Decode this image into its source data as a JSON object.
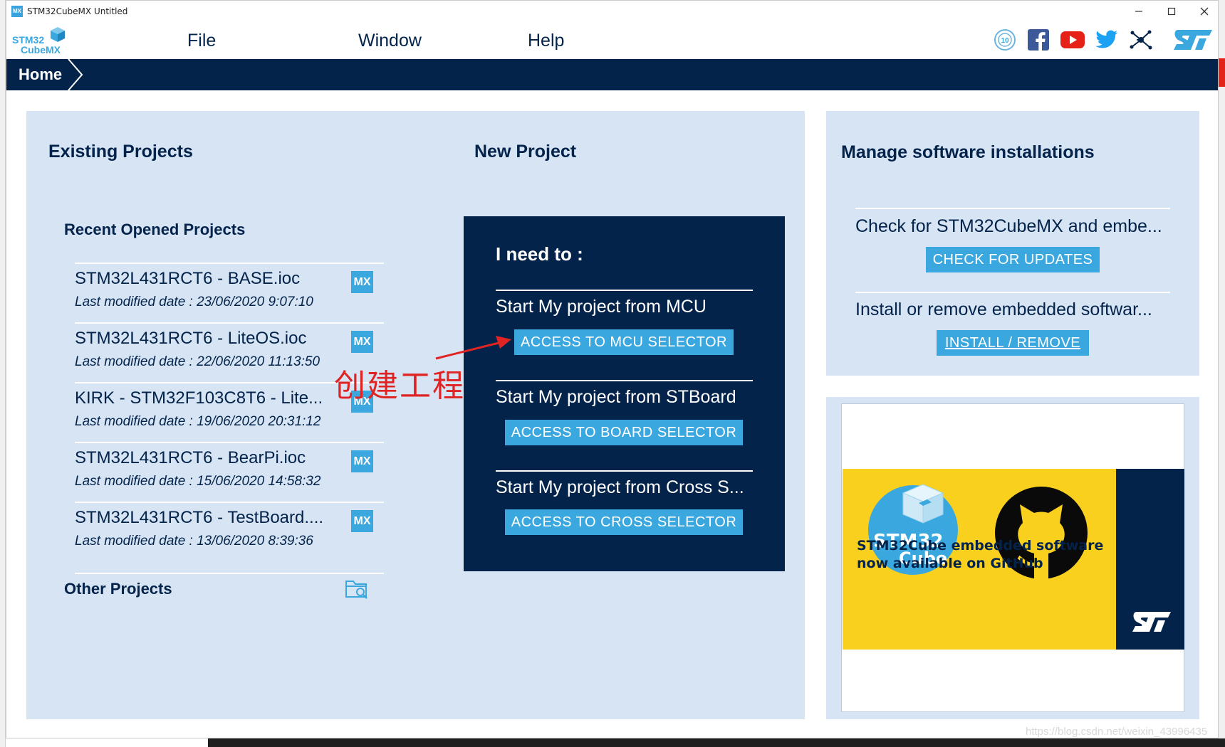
{
  "window": {
    "title": "STM32CubeMX Untitled",
    "app_icon_text": "MX",
    "controls": {
      "minimize": "—",
      "maximize": "☐",
      "close": "✕"
    }
  },
  "menubar": {
    "logo_text": [
      "STM32",
      "CubeMX"
    ],
    "items": [
      "File",
      "Window",
      "Help"
    ],
    "social_icons": [
      "ten-year-anniversary-icon",
      "facebook-icon",
      "youtube-icon",
      "twitter-icon",
      "network-icon",
      "st-logo-icon"
    ]
  },
  "breadcrumb": {
    "home": "Home"
  },
  "existing_projects": {
    "title": "Existing Projects",
    "recent_title": "Recent Opened Projects",
    "badge": "MX",
    "projects": [
      {
        "name": "STM32L431RCT6 - BASE.ioc",
        "date": "Last modified date : 23/06/2020 9:07:10"
      },
      {
        "name": "STM32L431RCT6 - LiteOS.ioc",
        "date": "Last modified date : 22/06/2020 11:13:50"
      },
      {
        "name": "KIRK - STM32F103C8T6 - Lite...",
        "date": "Last modified date : 19/06/2020 20:31:12"
      },
      {
        "name": "STM32L431RCT6 - BearPi.ioc",
        "date": "Last modified date : 15/06/2020 14:58:32"
      },
      {
        "name": "STM32L431RCT6 - TestBoard....",
        "date": "Last modified date : 13/06/2020 8:39:36"
      }
    ],
    "other_title": "Other Projects"
  },
  "new_project": {
    "title": "New Project",
    "need_to": "I need to :",
    "mcu_label": "Start My project from MCU",
    "mcu_button": "ACCESS TO MCU SELECTOR",
    "board_label": "Start My project from STBoard",
    "board_button": "ACCESS TO BOARD SELECTOR",
    "cross_label": "Start My project from Cross S...",
    "cross_button": "ACCESS TO CROSS SELECTOR"
  },
  "manage_software": {
    "title": "Manage software installations",
    "check_text": "Check for STM32CubeMX and embe...",
    "check_button": "CHECK FOR UPDATES",
    "install_text": "Install or remove embedded softwar...",
    "install_button": "INSTALL / REMOVE"
  },
  "banner": {
    "cube_text": [
      "STM32",
      "Cube"
    ],
    "text": "STM32Cube embedded software now available on GitHub"
  },
  "annotation": {
    "text": "创建工程"
  },
  "watermark": "https://blog.csdn.net/weixin_43996435",
  "colors": {
    "navy": "#03234b",
    "panel": "#d6e4f3",
    "accent": "#3ba7df",
    "banner_yellow": "#f9d01e",
    "annotation_red": "#e02424"
  }
}
